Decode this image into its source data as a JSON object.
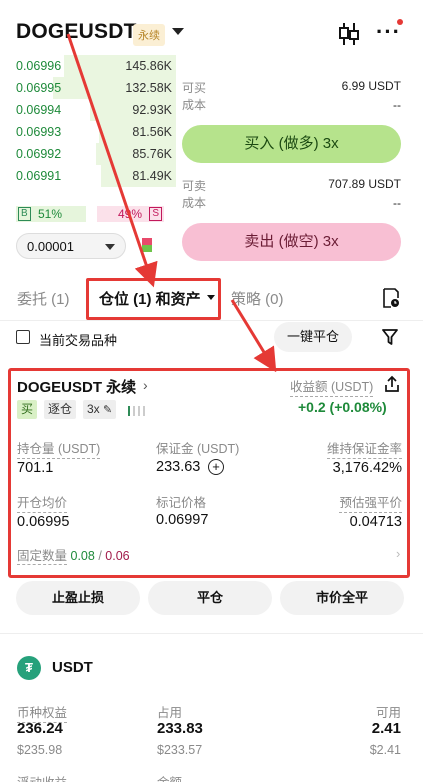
{
  "header": {
    "symbol": "DOGEUSDT",
    "contract_type": "永续"
  },
  "orderbook": {
    "rows": [
      {
        "price": "0.06996",
        "qty": "145.86K",
        "depth": 0.7
      },
      {
        "price": "0.06995",
        "qty": "132.58K",
        "depth": 0.77
      },
      {
        "price": "0.06994",
        "qty": "92.93K",
        "depth": 0.54
      },
      {
        "price": "0.06993",
        "qty": "81.56K",
        "depth": 0.48
      },
      {
        "price": "0.06992",
        "qty": "85.76K",
        "depth": 0.5
      },
      {
        "price": "0.06991",
        "qty": "81.49K",
        "depth": 0.47
      }
    ],
    "ratio": {
      "buy_tag": "B",
      "buy_pct": "51%",
      "sell_pct": "49%",
      "sell_tag": "S",
      "buy_share": 0.51
    },
    "precision": "0.00001"
  },
  "trade": {
    "can_buy_label": "可买",
    "can_buy_value": "6.99 USDT",
    "cost_label": "成本",
    "cost_value_buy": "--",
    "buy_button": "买入 (做多) 3x",
    "can_sell_label": "可卖",
    "can_sell_value": "707.89 USDT",
    "cost_value_sell": "--",
    "sell_button": "卖出 (做空) 3x"
  },
  "tabs": [
    {
      "label": "委托 (1)"
    },
    {
      "label": "仓位 (1) 和资产"
    },
    {
      "label": "策略 (0)"
    }
  ],
  "filters": {
    "current_only_label": "当前交易品种",
    "close_all_button": "一键平仓"
  },
  "position": {
    "title": "DOGEUSDT 永续",
    "pnl_label": "收益额 (USDT)",
    "pnl_value": "+0.2 (+0.08%)",
    "side_tag": "买",
    "margin_mode_tag": "逐仓",
    "leverage_tag": "3x",
    "fields": [
      {
        "label": "持仓量 (USDT)",
        "value": "701.1"
      },
      {
        "label": "保证金 (USDT)",
        "value": "233.63"
      },
      {
        "label": "维持保证金率",
        "value": "3,176.42%"
      },
      {
        "label": "开仓均价",
        "value": "0.06995"
      },
      {
        "label": "标记价格",
        "value": "0.06997"
      },
      {
        "label": "预估强平价",
        "value": "0.04713"
      }
    ],
    "fixed_qty_label": "固定数量",
    "fixed_qty_long": "0.08",
    "fixed_qty_sep": "/",
    "fixed_qty_short": "0.06",
    "actions": [
      "止盈止损",
      "平仓",
      "市价全平"
    ]
  },
  "asset": {
    "coin": "USDT",
    "coin_glyph": "₮",
    "cols": [
      {
        "label": "币种权益",
        "value": "236.24",
        "sub": "$235.98"
      },
      {
        "label": "占用",
        "value": "233.83",
        "sub": "$233.57"
      },
      {
        "label": "可用",
        "value": "2.41",
        "sub": "$2.41"
      }
    ],
    "row2_labels": [
      "浮动收益",
      "余额"
    ]
  },
  "colors": {
    "accent_highlight": "#e53935",
    "buy_green": "#b6e38c",
    "sell_pink": "#f8bfd3",
    "profit_green": "#1e8a3a"
  }
}
